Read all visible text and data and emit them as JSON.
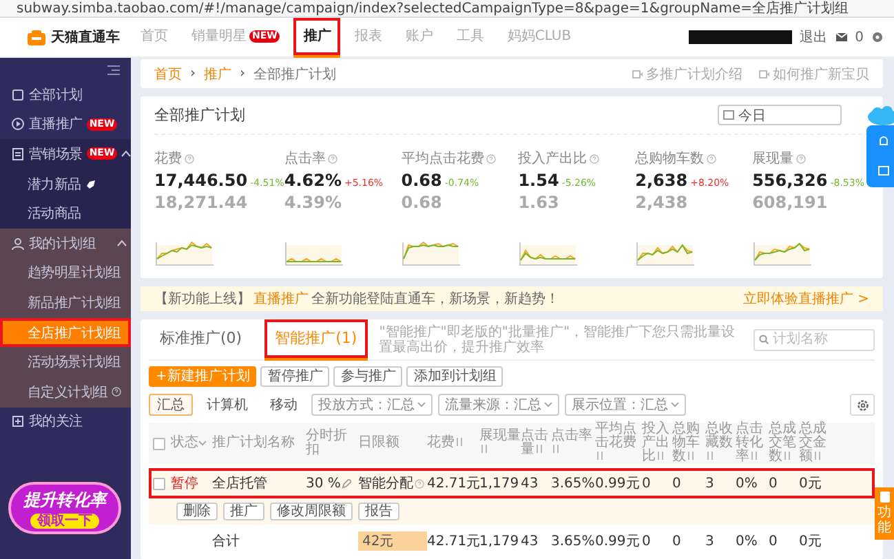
{
  "address_bar": {
    "url": "subway.simba.taobao.com/#!/manage/campaign/index?selectedCampaignType=8&page=1&groupName=全店推广计划组"
  },
  "header": {
    "logo": "天猫直通车",
    "logout": "退出",
    "mail_count": "0"
  },
  "nav": [
    {
      "label": "首页",
      "selected": false,
      "annotated": false
    },
    {
      "label": "销量明星",
      "badge": "NEW",
      "selected": false,
      "annotated": false
    },
    {
      "label": "推广",
      "selected": true,
      "annotated": true
    },
    {
      "label": "报表",
      "selected": false,
      "annotated": false
    },
    {
      "label": "账户",
      "selected": false,
      "annotated": false
    },
    {
      "label": "工具",
      "selected": false,
      "annotated": false
    },
    {
      "label": "妈妈CLUB",
      "selected": false,
      "annotated": false
    }
  ],
  "sidebar": {
    "items": [
      {
        "label": "全部计划",
        "kind": "item"
      },
      {
        "label": "直播推广",
        "kind": "item",
        "badge": "NEW"
      },
      {
        "label": "营销场景",
        "kind": "group",
        "badge": "NEW",
        "expanded": true,
        "children": [
          {
            "label": "潜力新品",
            "selected": false,
            "annotated": false,
            "rocket": true
          },
          {
            "label": "活动商品",
            "selected": false,
            "annotated": false
          }
        ]
      },
      {
        "label": "我的计划组",
        "kind": "group",
        "expanded": true,
        "children": [
          {
            "label": "趋势明星计划组",
            "selected": false,
            "annotated": false
          },
          {
            "label": "新品推广计划组",
            "selected": false,
            "annotated": false
          },
          {
            "label": "全店推广计划组",
            "selected": true,
            "annotated": true
          },
          {
            "label": "活动场景计划组",
            "selected": false,
            "annotated": false
          },
          {
            "label": "自定义计划组",
            "selected": false,
            "annotated": false,
            "help": true
          }
        ]
      },
      {
        "label": "我的关注",
        "kind": "item"
      }
    ],
    "promo": {
      "title": "提升转化率",
      "button": "领取一下"
    }
  },
  "breadcrumb": {
    "separator": "›",
    "items": [
      "首页",
      "推广",
      "全部推广计划"
    ],
    "links": [
      "多推广计划介绍",
      "如何推广新宝贝"
    ]
  },
  "overview": {
    "title": "全部推广计划",
    "date": "今日",
    "metrics": [
      {
        "label": "花费",
        "value": "17,446.50",
        "change": "-4.51%",
        "color": "#76b82a",
        "previous": "18,271.44"
      },
      {
        "label": "点击率",
        "value": "4.62%",
        "change": "+5.16%",
        "color": "#f23030",
        "previous": "4.39%"
      },
      {
        "label": "平均点击花费",
        "value": "0.68",
        "change": "-0.74%",
        "color": "#76b82a",
        "previous": "0.68"
      },
      {
        "label": "投入产出比",
        "value": "1.54",
        "change": "-5.26%",
        "color": "#76b82a",
        "previous": "1.63"
      },
      {
        "label": "总购物车数",
        "value": "2,638",
        "change": "+8.20%",
        "color": "#f23030",
        "previous": "2,438"
      },
      {
        "label": "展现量",
        "value": "556,326",
        "change": "-8.53%",
        "color": "#76b82a",
        "previous": "608,191"
      }
    ]
  },
  "notice": {
    "prefix": "【新功能上线】",
    "link": "直播推广",
    "text": "全新功能登陆直通车，新场景，新趋势！",
    "action": "立即体验直播推广 >"
  },
  "campaigns": {
    "tabs": [
      {
        "label": "标准推广(0)",
        "selected": false,
        "annotated": false
      },
      {
        "label": "智能推广(1)",
        "selected": true,
        "annotated": true
      }
    ],
    "description": "\"智能推广\"即老版的\"批量推广\"，智能推广下您只需批量设置最高出价，提升推广效率",
    "search": {
      "placeholder": "计划名称"
    },
    "actions": [
      {
        "label": "+新建推广计划",
        "kind": "primary"
      },
      {
        "label": "暂停推广",
        "kind": "plain"
      },
      {
        "label": "参与推广",
        "kind": "plain"
      },
      {
        "label": "添加到计划组",
        "kind": "plain"
      }
    ],
    "devices": [
      {
        "label": "汇总",
        "selected": true
      },
      {
        "label": "计算机",
        "selected": false
      },
      {
        "label": "移动",
        "selected": false
      }
    ],
    "filters": [
      "投放方式：汇总",
      "流量来源：汇总",
      "展示位置：汇总"
    ],
    "columns": [
      "状态",
      "推广计划名称",
      "分时折扣",
      "日限额",
      "花费",
      "展现量",
      "点击量",
      "点击率",
      "平均点击花费",
      "投入产出比",
      "总购物车数",
      "总收藏数",
      "点击转化率",
      "总成交笔数",
      "总成交金额"
    ],
    "select_all_checked": false,
    "rows": [
      {
        "checked": false,
        "status": "暂停",
        "color": "#e8161b",
        "name": "全店托管",
        "discount": "30 %",
        "budget": "智能分配",
        "values": [
          "42.71元",
          "1,179",
          "43",
          "3.65%",
          "0.99元",
          "0",
          "0",
          "3",
          "0%",
          "0",
          "0元"
        ],
        "annotated": true,
        "buttons": [
          "删除",
          "推广",
          "修改周限额",
          "报告"
        ]
      }
    ],
    "total": {
      "label": "合计",
      "budget": "42元",
      "values": [
        "42.71元",
        "1,179",
        "43",
        "3.65%",
        "0.99元",
        "0",
        "0",
        "3",
        "0%",
        "0",
        "0元"
      ]
    }
  },
  "side_tab": {
    "label": "功能"
  }
}
